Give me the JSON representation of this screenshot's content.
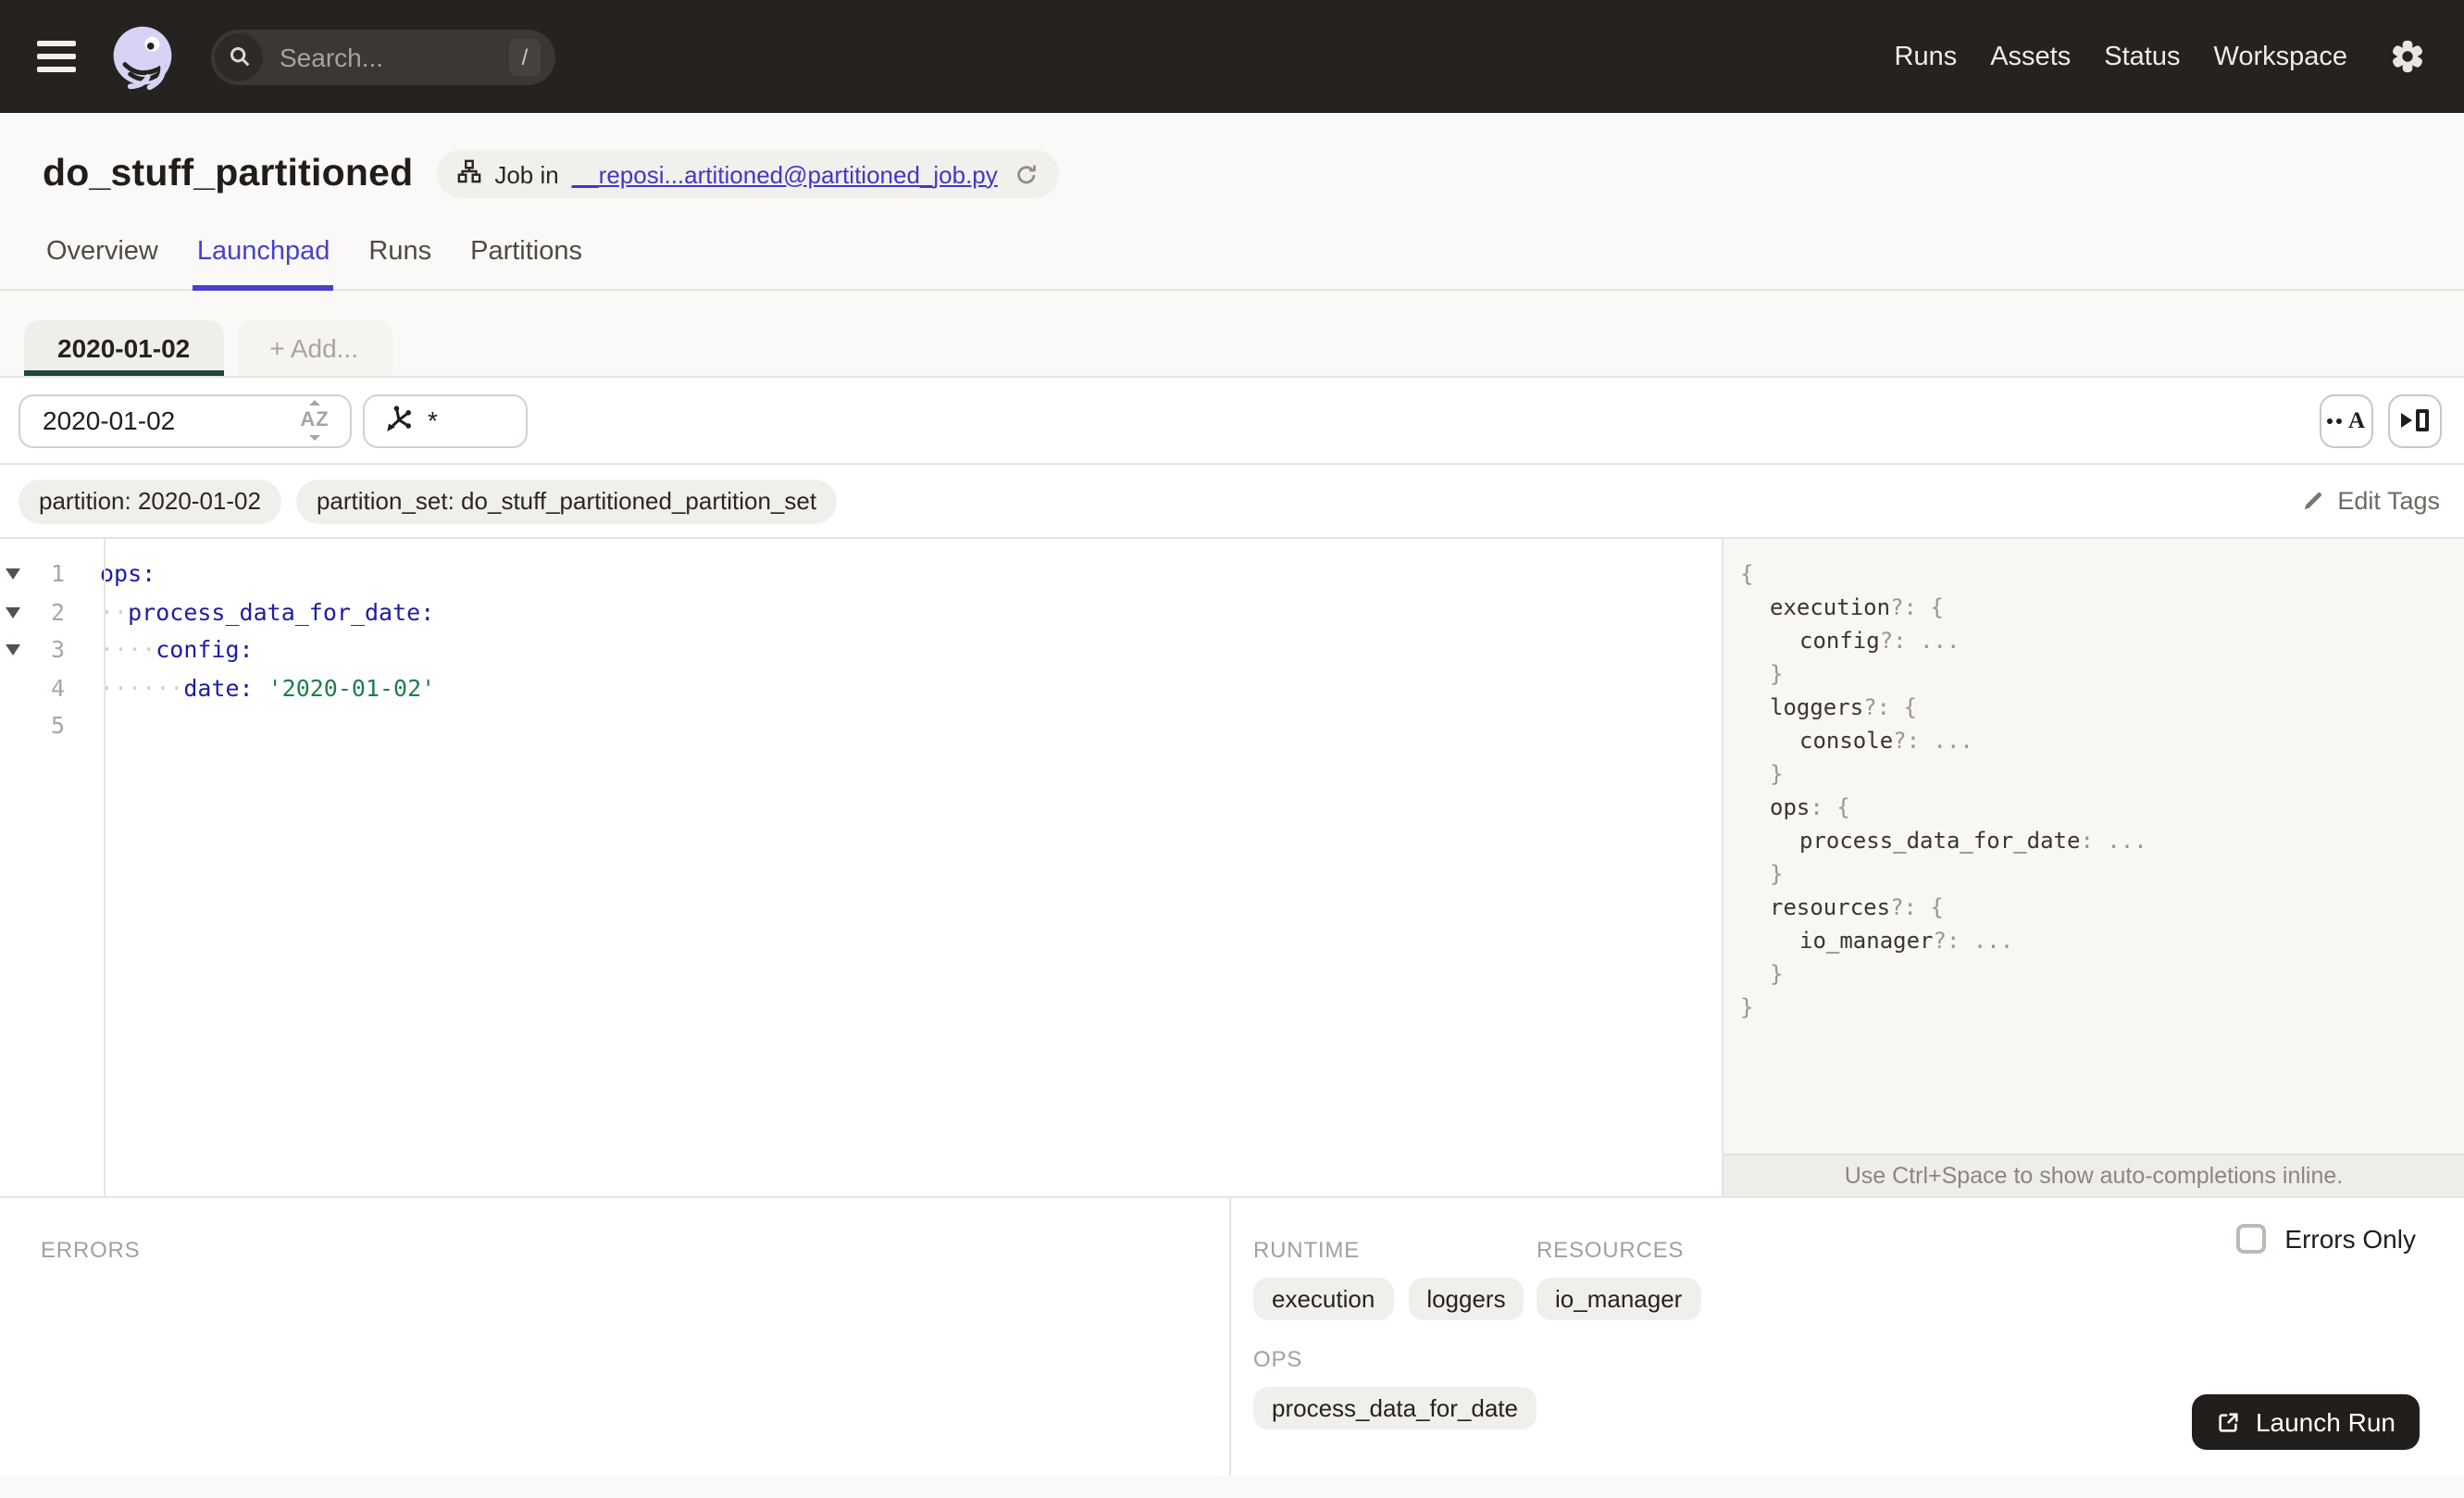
{
  "topbar": {
    "search": {
      "placeholder": "Search...",
      "shortcut": "/"
    },
    "nav": [
      "Runs",
      "Assets",
      "Status",
      "Workspace"
    ]
  },
  "header": {
    "title": "do_stuff_partitioned",
    "job_badge": {
      "prefix": "Job in",
      "link": "__reposi...artitioned@partitioned_job.py"
    }
  },
  "tabs": [
    {
      "label": "Overview",
      "active": false
    },
    {
      "label": "Launchpad",
      "active": true
    },
    {
      "label": "Runs",
      "active": false
    },
    {
      "label": "Partitions",
      "active": false
    }
  ],
  "config_tabs": {
    "active_label": "2020-01-02",
    "add_label": "+ Add..."
  },
  "toolbar": {
    "partition_value": "2020-01-02",
    "op_query_value": "*"
  },
  "tags": {
    "items": [
      "partition: 2020-01-02",
      "partition_set: do_stuff_partitioned_partition_set"
    ],
    "edit_label": "Edit Tags"
  },
  "editor": {
    "lines": [
      {
        "num": "1",
        "fold": true,
        "indent": 0,
        "key": "ops:",
        "value": ""
      },
      {
        "num": "2",
        "fold": true,
        "indent": 2,
        "key": "process_data_for_date:",
        "value": ""
      },
      {
        "num": "3",
        "fold": true,
        "indent": 4,
        "key": "config:",
        "value": ""
      },
      {
        "num": "4",
        "fold": false,
        "indent": 6,
        "key": "date:",
        "value": "'2020-01-02'"
      },
      {
        "num": "5",
        "fold": false,
        "indent": 0,
        "key": "",
        "value": ""
      }
    ]
  },
  "schema_panel": {
    "lines": [
      {
        "i": 0,
        "segs": [
          {
            "t": "{",
            "c": "p"
          }
        ]
      },
      {
        "i": 1,
        "segs": [
          {
            "t": "execution",
            "c": "k"
          },
          {
            "t": "?: {",
            "c": "p"
          }
        ]
      },
      {
        "i": 2,
        "segs": [
          {
            "t": "config",
            "c": "k"
          },
          {
            "t": "?: ...",
            "c": "p"
          }
        ]
      },
      {
        "i": 1,
        "segs": [
          {
            "t": "}",
            "c": "p"
          }
        ]
      },
      {
        "i": 1,
        "segs": [
          {
            "t": "loggers",
            "c": "k"
          },
          {
            "t": "?: {",
            "c": "p"
          }
        ]
      },
      {
        "i": 2,
        "segs": [
          {
            "t": "console",
            "c": "k"
          },
          {
            "t": "?: ...",
            "c": "p"
          }
        ]
      },
      {
        "i": 1,
        "segs": [
          {
            "t": "}",
            "c": "p"
          }
        ]
      },
      {
        "i": 1,
        "segs": [
          {
            "t": "ops",
            "c": "k"
          },
          {
            "t": ": {",
            "c": "p"
          }
        ]
      },
      {
        "i": 2,
        "segs": [
          {
            "t": "process_data_for_date",
            "c": "k"
          },
          {
            "t": ": ...",
            "c": "p"
          }
        ]
      },
      {
        "i": 1,
        "segs": [
          {
            "t": "}",
            "c": "p"
          }
        ]
      },
      {
        "i": 1,
        "segs": [
          {
            "t": "resources",
            "c": "k"
          },
          {
            "t": "?: {",
            "c": "p"
          }
        ]
      },
      {
        "i": 2,
        "segs": [
          {
            "t": "io_manager",
            "c": "k"
          },
          {
            "t": "?: ...",
            "c": "p"
          }
        ]
      },
      {
        "i": 1,
        "segs": [
          {
            "t": "}",
            "c": "p"
          }
        ]
      },
      {
        "i": 0,
        "segs": [
          {
            "t": "}",
            "c": "p"
          }
        ]
      }
    ],
    "hint": "Use Ctrl+Space to show auto-completions inline."
  },
  "bottom": {
    "errors_label": "ERRORS",
    "runtime_label": "RUNTIME",
    "runtime_items": [
      "execution",
      "loggers"
    ],
    "resources_label": "RESOURCES",
    "resources_items": [
      "io_manager"
    ],
    "ops_label": "OPS",
    "ops_items": [
      "process_data_for_date"
    ],
    "errors_only_label": "Errors Only",
    "launch_button": "Launch Run"
  },
  "colors": {
    "topbar_bg": "#262220",
    "accent_blue": "#4741CE",
    "link_blue": "#3F38C8",
    "config_tab_underline": "#21453B",
    "code_key": "#1D1DA5",
    "code_string": "#1E7E4D",
    "launch_button_bg": "#221E1B",
    "logo_lavender": "#D8D2F4"
  }
}
